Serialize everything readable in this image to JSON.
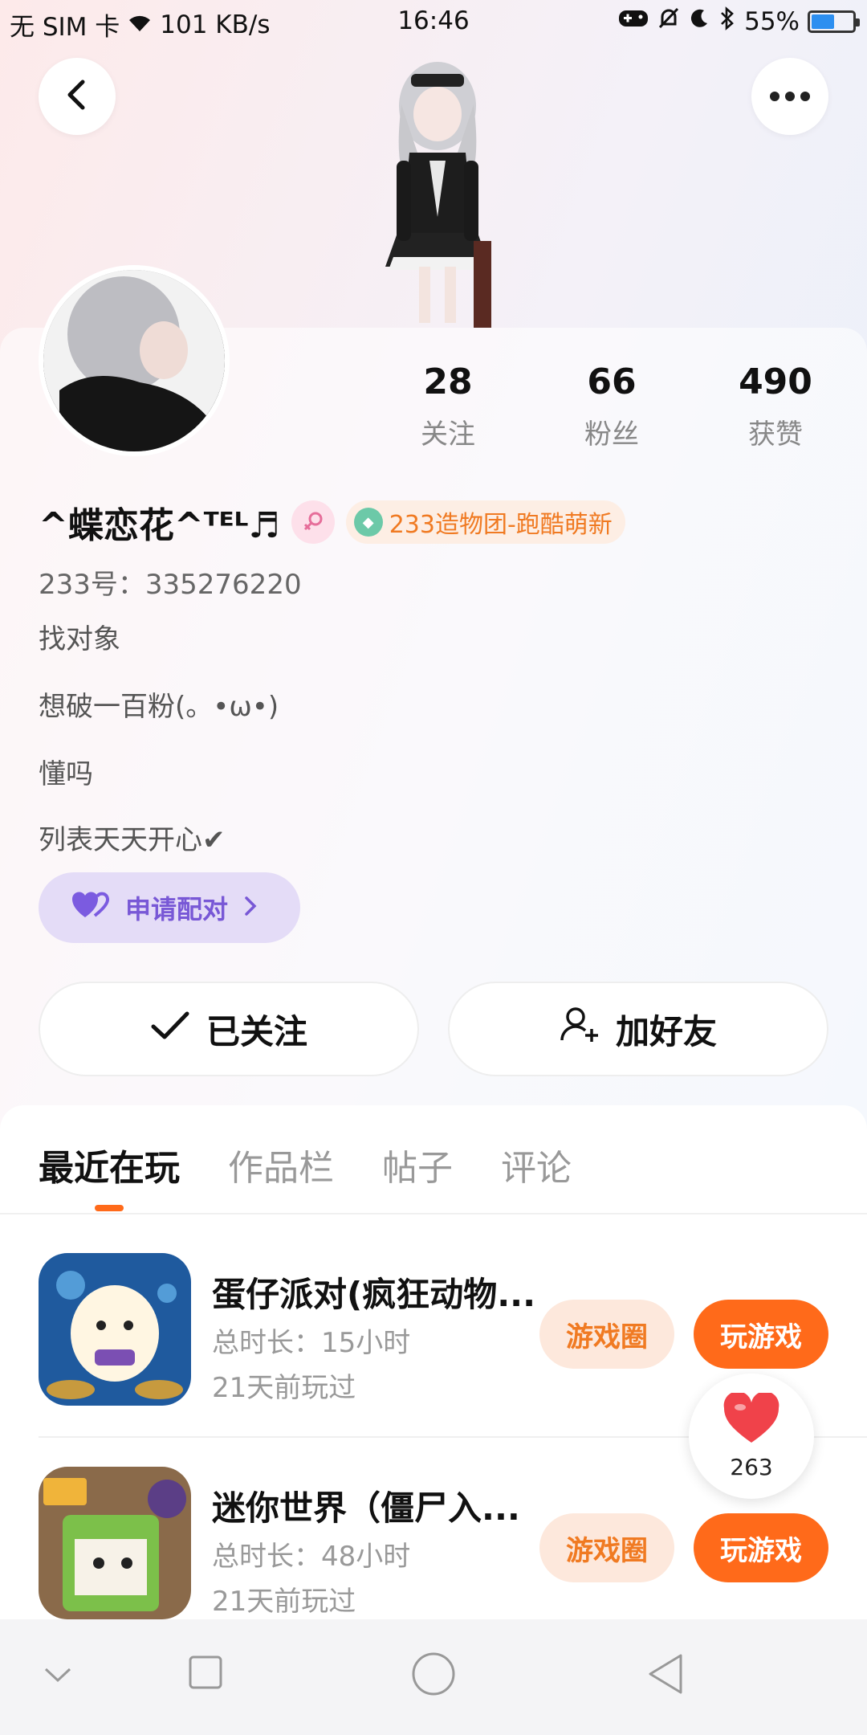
{
  "status_bar": {
    "carrier": "无 SIM 卡",
    "speed": "101 KB/s",
    "time": "16:46",
    "battery": "55%",
    "battery_level": 0.55
  },
  "profile": {
    "stats": [
      {
        "value": "28",
        "label": "关注"
      },
      {
        "value": "66",
        "label": "粉丝"
      },
      {
        "value": "490",
        "label": "获赞"
      }
    ],
    "name": "^蝶恋花^ᵀᴱᴸ♬",
    "team_badge": "233造物团-跑酷萌新",
    "uid": "233号：335276220",
    "bio": [
      "找对象",
      "想破一百粉(。•ω•)",
      "懂吗",
      "列表天天开心✔"
    ],
    "match_button": "申请配对",
    "follow_button": "已关注",
    "add_friend_button": "加好友"
  },
  "tabs": [
    "最近在玩",
    "作品栏",
    "帖子",
    "评论"
  ],
  "games": [
    {
      "title": "蛋仔派对(疯狂动物...",
      "duration": "总时长：15小时",
      "last_played": "21天前玩过",
      "circle_label": "游戏圈",
      "play_label": "玩游戏"
    },
    {
      "title": "迷你世界（僵尸入...",
      "duration": "总时长：48小时",
      "last_played": "21天前玩过",
      "circle_label": "游戏圈",
      "play_label": "玩游戏"
    }
  ],
  "like": {
    "count": "263"
  },
  "colors": {
    "accent": "#ff6a1a",
    "match_purple": "#7858d6",
    "like_red": "#f0424a"
  }
}
